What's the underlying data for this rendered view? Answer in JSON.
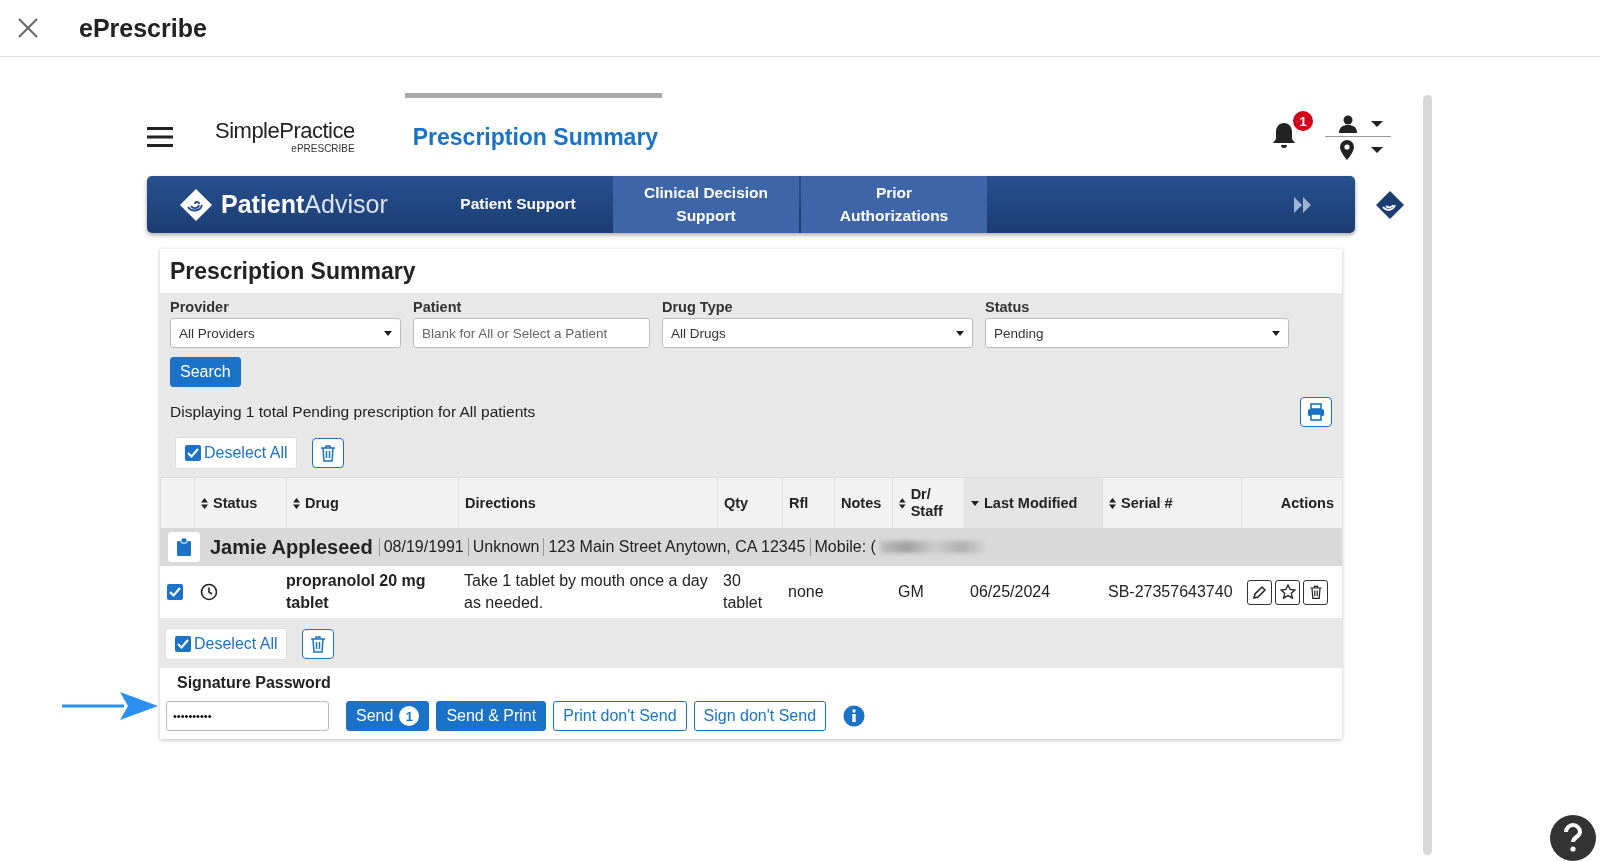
{
  "window": {
    "title": "ePrescribe"
  },
  "app": {
    "logo": {
      "name": "SimplePractice",
      "sub": "ePRESCRIBE"
    },
    "page_title": "Prescription Summary",
    "notifications": "1"
  },
  "navbar": {
    "brand": {
      "bold": "Patient",
      "light": "Advisor"
    },
    "tabs": [
      {
        "label": "Patient Support",
        "highlighted": false
      },
      {
        "label": "Clinical Decision Support",
        "highlighted": true
      },
      {
        "label": "Prior Authorizations",
        "highlighted": true
      }
    ]
  },
  "summary": {
    "title": "Prescription Summary",
    "filters": [
      {
        "label": "Provider",
        "kind": "select",
        "value": "All Providers"
      },
      {
        "label": "Patient",
        "kind": "text",
        "placeholder": "Blank for All or Select a Patient"
      },
      {
        "label": "Drug Type",
        "kind": "select",
        "value": "All Drugs"
      },
      {
        "label": "Status",
        "kind": "select",
        "value": "Pending"
      }
    ],
    "search_button": "Search",
    "result_text": "Displaying 1 total Pending prescription for All patients",
    "deselect_top": {
      "label": "Deselect All",
      "checked": true
    },
    "table": {
      "columns": [
        {
          "label": "Status",
          "sortable": true,
          "sorted": false
        },
        {
          "label": "Drug",
          "sortable": true,
          "sorted": false
        },
        {
          "label": "Directions",
          "sortable": false,
          "sorted": false
        },
        {
          "label": "Qty",
          "sortable": false,
          "sorted": false
        },
        {
          "label": "Rfl",
          "sortable": false,
          "sorted": false
        },
        {
          "label": "Notes",
          "sortable": false,
          "sorted": false
        },
        {
          "label": "Dr/ Staff",
          "sortable": true,
          "sorted": false
        },
        {
          "label": "Last Modified",
          "sortable": true,
          "sorted": true
        },
        {
          "label": "Serial #",
          "sortable": true,
          "sorted": false
        },
        {
          "label": "Actions",
          "sortable": false,
          "sorted": false
        }
      ],
      "patient": {
        "name": "Jamie Appleseed",
        "details": [
          "08/19/1991",
          "Unknown",
          "123 Main Street Anytown, CA 12345",
          "Mobile: ("
        ]
      },
      "rows": [
        {
          "checked": true,
          "drug": "propranolol 20 mg tablet",
          "directions": "Take 1 tablet by mouth once a day as needed.",
          "qty": "30 tablet",
          "rfl": "none",
          "dr_staff": "GM",
          "last_modified": "06/25/2024",
          "serial": "SB-27357643740"
        }
      ]
    },
    "deselect_bottom": {
      "label": "Deselect All",
      "checked": true
    },
    "signature": {
      "label": "Signature Password",
      "value": "••••••••••",
      "buttons": [
        {
          "label": "Send",
          "kind": "primary",
          "count": "1"
        },
        {
          "label": "Send & Print",
          "kind": "primary"
        },
        {
          "label": "Print don't Send",
          "kind": "outline"
        },
        {
          "label": "Sign don't Send",
          "kind": "outline"
        }
      ]
    }
  }
}
